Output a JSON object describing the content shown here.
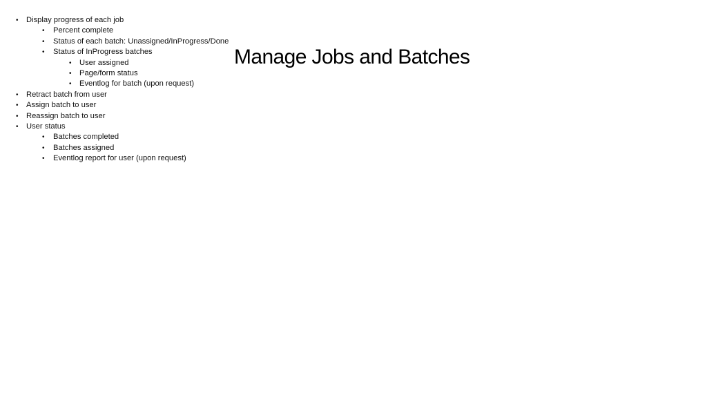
{
  "slide": {
    "title": "Manage Jobs and Batches",
    "bullet_char": "•",
    "bullets": [
      {
        "level": 0,
        "text": "Display progress of each job"
      },
      {
        "level": 1,
        "text": "Percent complete"
      },
      {
        "level": 1,
        "text": "Status of each batch: Unassigned/InProgress/Done"
      },
      {
        "level": 1,
        "text": "Status of InProgress batches"
      },
      {
        "level": 2,
        "text": "User assigned"
      },
      {
        "level": 2,
        "text": "Page/form status"
      },
      {
        "level": 2,
        "text": "Eventlog for batch (upon request)"
      },
      {
        "level": 0,
        "text": "Retract batch from user"
      },
      {
        "level": 0,
        "text": "Assign batch to user"
      },
      {
        "level": 0,
        "text": "Reassign batch to user"
      },
      {
        "level": 0,
        "text": "User status"
      },
      {
        "level": 1,
        "text": "Batches completed"
      },
      {
        "level": 1,
        "text": "Batches assigned"
      },
      {
        "level": 1,
        "text": "Eventlog report for user (upon request)"
      }
    ]
  }
}
